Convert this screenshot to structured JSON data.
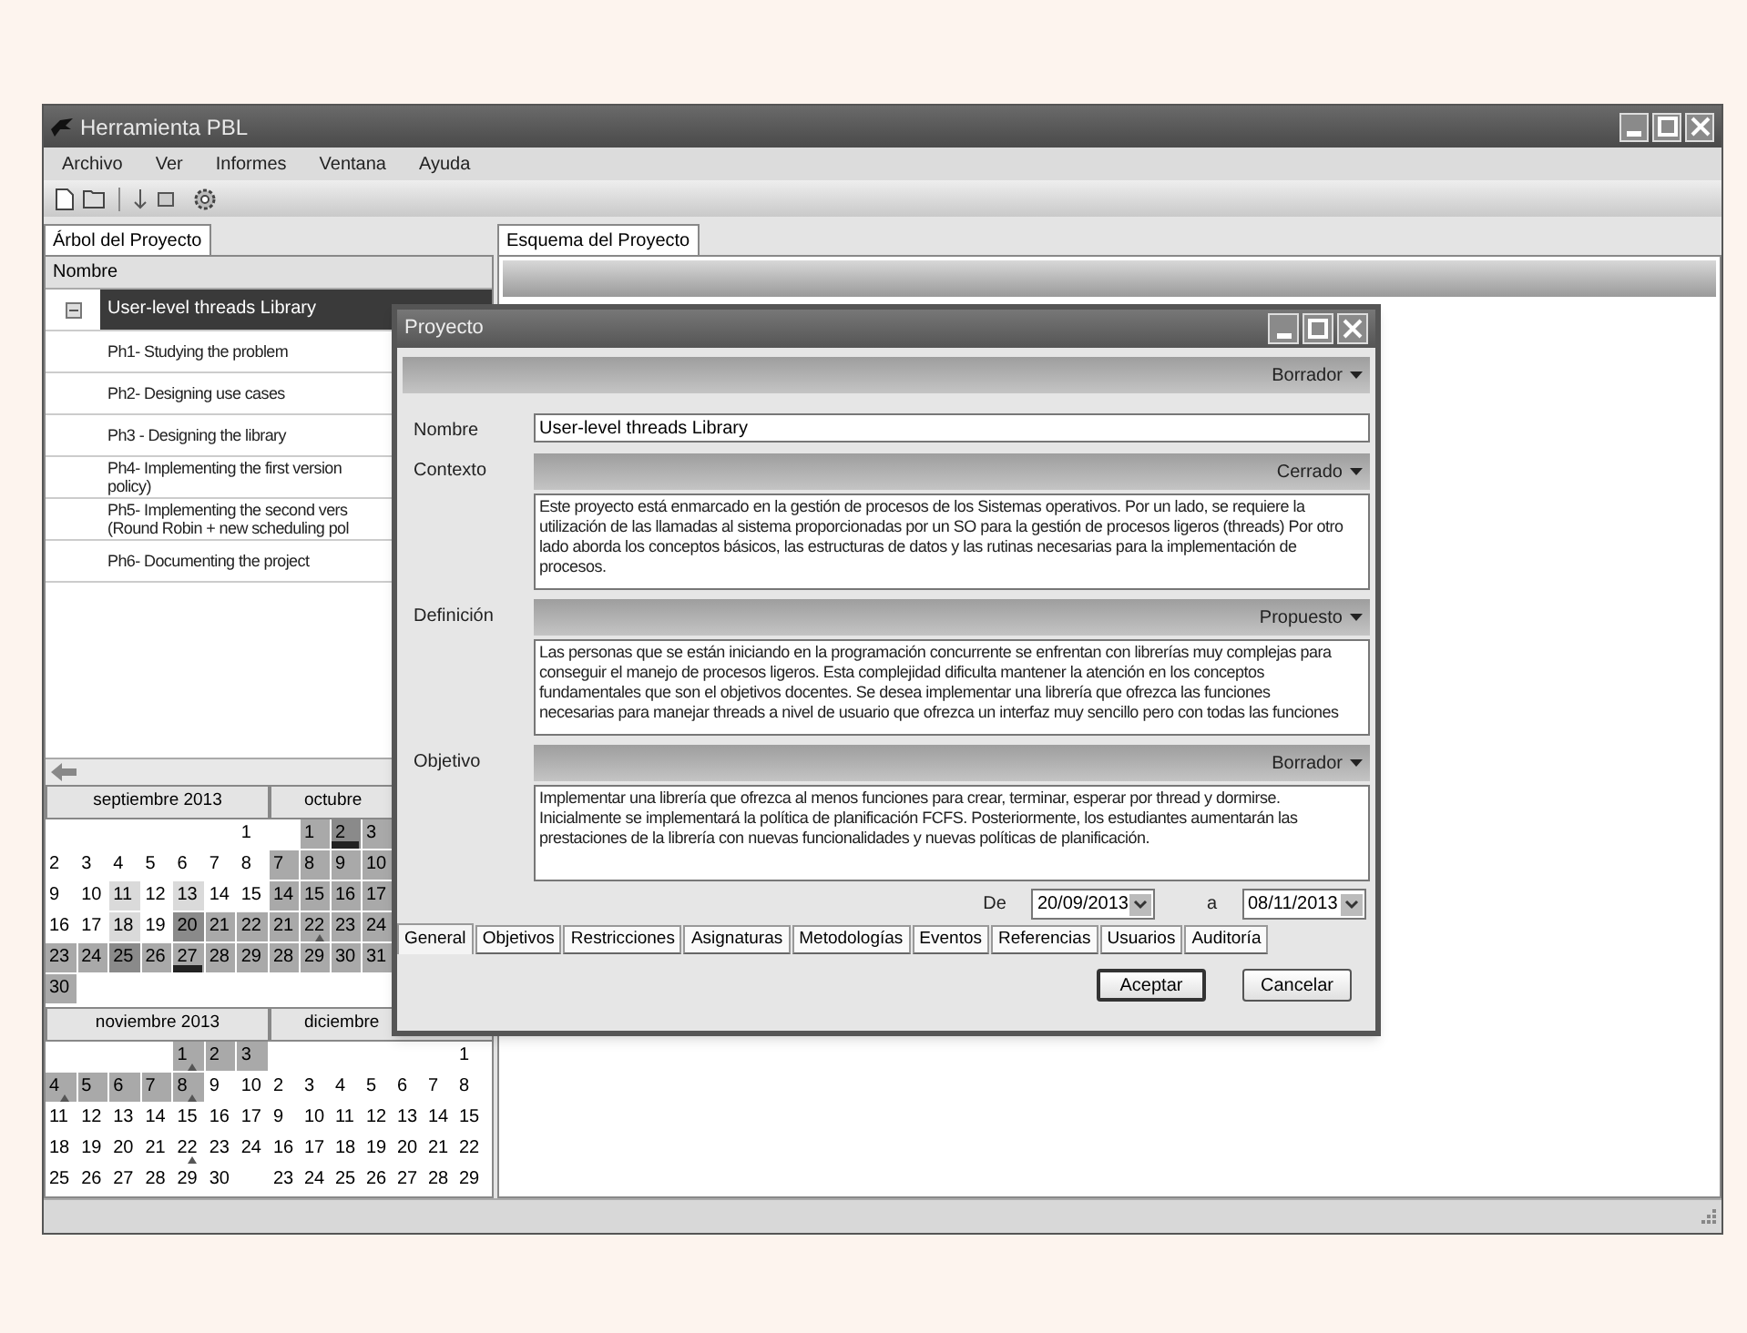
{
  "window": {
    "title": "Herramienta PBL"
  },
  "menu": [
    "Archivo",
    "Ver",
    "Informes",
    "Ventana",
    "Ayuda"
  ],
  "left_tab": {
    "label": "Árbol del Proyecto",
    "selected": true
  },
  "tree": {
    "column": "Nombre",
    "items": [
      {
        "lines": [
          "User-level threads Library"
        ],
        "selected": true,
        "expanded": true,
        "children": [
          {
            "lines": [
              "Ph1- Studying the problem"
            ],
            "selected": false
          },
          {
            "lines": [
              "Ph2- Designing use cases"
            ],
            "selected": false
          },
          {
            "lines": [
              "Ph3 - Designing the library"
            ],
            "selected": false
          },
          {
            "lines": [
              "Ph4- Implementing the first version",
              "policy)"
            ],
            "selected": false
          },
          {
            "lines": [
              "Ph5- Implementing the second vers",
              "(Round Robin + new scheduling pol"
            ],
            "selected": false
          },
          {
            "lines": [
              "Ph6- Documenting the project"
            ],
            "selected": false
          }
        ]
      }
    ]
  },
  "calendars": [
    {
      "title": "septiembre 2013",
      "weeks": [
        [
          {
            "kind": "blank"
          },
          {
            "kind": "blank"
          },
          {
            "kind": "blank"
          },
          {
            "kind": "blank"
          },
          {
            "kind": "blank"
          },
          {
            "kind": "blank"
          },
          {
            "kind": "day",
            "day": "1"
          }
        ],
        [
          {
            "kind": "day",
            "day": "2"
          },
          {
            "kind": "day",
            "day": "3"
          },
          {
            "kind": "day",
            "day": "4"
          },
          {
            "kind": "day",
            "day": "5"
          },
          {
            "kind": "day",
            "day": "6"
          },
          {
            "kind": "day",
            "day": "7"
          },
          {
            "kind": "day",
            "day": "8"
          }
        ],
        [
          {
            "kind": "day",
            "day": "9"
          },
          {
            "kind": "day",
            "day": "10"
          },
          {
            "kind": "day",
            "day": "11",
            "color": "#dadada"
          },
          {
            "kind": "day",
            "day": "12"
          },
          {
            "kind": "day",
            "day": "13",
            "color": "#dadada"
          },
          {
            "kind": "day",
            "day": "14"
          },
          {
            "kind": "day",
            "day": "15"
          }
        ],
        [
          {
            "kind": "day",
            "day": "16"
          },
          {
            "kind": "day",
            "day": "17"
          },
          {
            "kind": "day",
            "day": "18",
            "color": "#dadada"
          },
          {
            "kind": "day",
            "day": "19"
          },
          {
            "kind": "day",
            "day": "20",
            "color": "#8a8a8a"
          },
          {
            "kind": "day",
            "day": "21",
            "color": "#a9a9a9"
          },
          {
            "kind": "day",
            "day": "22",
            "color": "#a9a9a9"
          }
        ],
        [
          {
            "kind": "day",
            "day": "23",
            "color": "#a9a9a9"
          },
          {
            "kind": "day",
            "day": "24",
            "color": "#a9a9a9"
          },
          {
            "kind": "day",
            "day": "25",
            "color": "#8a8a8a"
          },
          {
            "kind": "day",
            "day": "26",
            "color": "#a9a9a9"
          },
          {
            "kind": "day",
            "day": "27",
            "color": "#a9a9a9",
            "underlined": true
          },
          {
            "kind": "day",
            "day": "28",
            "color": "#a9a9a9"
          },
          {
            "kind": "day",
            "day": "29",
            "color": "#a9a9a9"
          }
        ],
        [
          {
            "kind": "day",
            "day": "30",
            "color": "#a9a9a9"
          }
        ]
      ]
    },
    {
      "title": "octubre",
      "weeks": [
        [
          {
            "kind": "blank"
          },
          {
            "kind": "day",
            "day": "1",
            "color": "#a9a9a9"
          },
          {
            "kind": "day",
            "day": "2",
            "color": "#8a8a8a",
            "underlined": true
          },
          {
            "kind": "day",
            "day": "3",
            "color": "#a9a9a9"
          }
        ],
        [
          {
            "kind": "day",
            "day": "7",
            "color": "#a9a9a9"
          },
          {
            "kind": "day",
            "day": "8",
            "color": "#a9a9a9"
          },
          {
            "kind": "day",
            "day": "9",
            "color": "#a9a9a9"
          },
          {
            "kind": "day",
            "day": "10",
            "color": "#a9a9a9"
          }
        ],
        [
          {
            "kind": "day",
            "day": "14",
            "color": "#a9a9a9"
          },
          {
            "kind": "day",
            "day": "15",
            "color": "#a9a9a9"
          },
          {
            "kind": "day",
            "day": "16",
            "color": "#a9a9a9"
          },
          {
            "kind": "day",
            "day": "17",
            "color": "#a9a9a9"
          }
        ],
        [
          {
            "kind": "day",
            "day": "21",
            "color": "#a9a9a9"
          },
          {
            "kind": "day",
            "day": "22",
            "color": "#a9a9a9",
            "marked": true
          },
          {
            "kind": "day",
            "day": "23",
            "color": "#a9a9a9"
          },
          {
            "kind": "day",
            "day": "24",
            "color": "#a9a9a9"
          }
        ],
        [
          {
            "kind": "day",
            "day": "28",
            "color": "#a9a9a9"
          },
          {
            "kind": "day",
            "day": "29",
            "color": "#a9a9a9"
          },
          {
            "kind": "day",
            "day": "30",
            "color": "#a9a9a9"
          },
          {
            "kind": "day",
            "day": "31",
            "color": "#a9a9a9"
          }
        ]
      ]
    },
    {
      "title": "noviembre 2013",
      "weeks": [
        [
          {
            "kind": "blank"
          },
          {
            "kind": "blank"
          },
          {
            "kind": "blank"
          },
          {
            "kind": "blank"
          },
          {
            "kind": "day",
            "day": "1",
            "color": "#a9a9a9",
            "marked": true
          },
          {
            "kind": "day",
            "day": "2",
            "color": "#a9a9a9"
          },
          {
            "kind": "day",
            "day": "3",
            "color": "#a9a9a9"
          }
        ],
        [
          {
            "kind": "day",
            "day": "4",
            "color": "#a9a9a9",
            "marked": true
          },
          {
            "kind": "day",
            "day": "5",
            "color": "#a9a9a9"
          },
          {
            "kind": "day",
            "day": "6",
            "color": "#a9a9a9"
          },
          {
            "kind": "day",
            "day": "7",
            "color": "#a9a9a9"
          },
          {
            "kind": "day",
            "day": "8",
            "color": "#a9a9a9",
            "marked": true
          },
          {
            "kind": "day",
            "day": "9"
          },
          {
            "kind": "day",
            "day": "10"
          }
        ],
        [
          {
            "kind": "day",
            "day": "11"
          },
          {
            "kind": "day",
            "day": "12"
          },
          {
            "kind": "day",
            "day": "13"
          },
          {
            "kind": "day",
            "day": "14"
          },
          {
            "kind": "day",
            "day": "15"
          },
          {
            "kind": "day",
            "day": "16"
          },
          {
            "kind": "day",
            "day": "17"
          }
        ],
        [
          {
            "kind": "day",
            "day": "18"
          },
          {
            "kind": "day",
            "day": "19"
          },
          {
            "kind": "day",
            "day": "20"
          },
          {
            "kind": "day",
            "day": "21"
          },
          {
            "kind": "day",
            "day": "22",
            "marked": true
          },
          {
            "kind": "day",
            "day": "23"
          },
          {
            "kind": "day",
            "day": "24"
          }
        ],
        [
          {
            "kind": "day",
            "day": "25"
          },
          {
            "kind": "day",
            "day": "26"
          },
          {
            "kind": "day",
            "day": "27"
          },
          {
            "kind": "day",
            "day": "28"
          },
          {
            "kind": "day",
            "day": "29"
          },
          {
            "kind": "day",
            "day": "30"
          }
        ]
      ]
    },
    {
      "title": "diciembre",
      "weeks": [
        [
          {
            "kind": "blank"
          },
          {
            "kind": "blank"
          },
          {
            "kind": "blank"
          },
          {
            "kind": "blank"
          },
          {
            "kind": "blank"
          },
          {
            "kind": "blank"
          },
          {
            "kind": "day",
            "day": "1"
          }
        ],
        [
          {
            "kind": "day",
            "day": "2"
          },
          {
            "kind": "day",
            "day": "3"
          },
          {
            "kind": "day",
            "day": "4"
          },
          {
            "kind": "day",
            "day": "5"
          },
          {
            "kind": "day",
            "day": "6"
          },
          {
            "kind": "day",
            "day": "7"
          },
          {
            "kind": "day",
            "day": "8"
          }
        ],
        [
          {
            "kind": "day",
            "day": "9"
          },
          {
            "kind": "day",
            "day": "10"
          },
          {
            "kind": "day",
            "day": "11"
          },
          {
            "kind": "day",
            "day": "12"
          },
          {
            "kind": "day",
            "day": "13"
          },
          {
            "kind": "day",
            "day": "14"
          },
          {
            "kind": "day",
            "day": "15"
          }
        ],
        [
          {
            "kind": "day",
            "day": "16"
          },
          {
            "kind": "day",
            "day": "17"
          },
          {
            "kind": "day",
            "day": "18"
          },
          {
            "kind": "day",
            "day": "19"
          },
          {
            "kind": "day",
            "day": "20"
          },
          {
            "kind": "day",
            "day": "21"
          },
          {
            "kind": "day",
            "day": "22"
          }
        ],
        [
          {
            "kind": "day",
            "day": "23"
          },
          {
            "kind": "day",
            "day": "24"
          },
          {
            "kind": "day",
            "day": "25"
          },
          {
            "kind": "day",
            "day": "26"
          },
          {
            "kind": "day",
            "day": "27"
          },
          {
            "kind": "day",
            "day": "28"
          },
          {
            "kind": "day",
            "day": "29"
          }
        ]
      ]
    }
  ],
  "right_tab": {
    "label": "Esquema del Proyecto",
    "selected": true
  },
  "dialog": {
    "title": "Proyecto",
    "status": "Borrador",
    "fields": [
      {
        "kind": "input",
        "label": "Nombre",
        "value": "User-level threads Library"
      },
      {
        "kind": "text",
        "label": "Contexto",
        "status": "Cerrado",
        "lines": [
          "Este proyecto está enmarcado en la gestión de procesos de los Sistemas operativos. Por un lado, se requiere la",
          "utilización de las llamadas al sistema proporcionadas por un SO para la gestión de procesos ligeros (threads) Por otro",
          "lado aborda los conceptos básicos, las estructuras de datos y las rutinas necesarias para la implementación de",
          "procesos."
        ]
      },
      {
        "kind": "text",
        "label": "Definición",
        "status": "Propuesto",
        "lines": [
          "Las personas que se están iniciando en la programación concurrente se enfrentan con librerías muy complejas para",
          "conseguir el manejo de procesos ligeros. Esta complejidad dificulta mantener la atención en los conceptos",
          "fundamentales que son el objetivos docentes. Se desea implementar una librería que ofrezca las funciones",
          "necesarias para manejar threads a nivel de usuario que ofrezca un interfaz muy sencillo pero con todas las funciones"
        ]
      },
      {
        "kind": "text",
        "label": "Objetivo",
        "status": "Borrador",
        "lines": [
          "Implementar una librería que ofrezca al menos funciones para crear, terminar, esperar por thread y dormirse.",
          "Inicialmente se implementará la política de planificación FCFS. Posteriormente, los estudiantes  aumentarán las",
          "prestaciones de la librería con nuevas funcionalidades y nuevas políticas de planificación."
        ]
      }
    ],
    "date_from_label": "De",
    "date_from": "20/09/2013",
    "date_to_label": "a",
    "date_to": "08/11/2013",
    "tabs": [
      {
        "label": "General",
        "selected": true
      },
      {
        "label": "Objetivos",
        "selected": false
      },
      {
        "label": "Restricciones",
        "selected": false
      },
      {
        "label": "Asignaturas",
        "selected": false
      },
      {
        "label": "Metodologías",
        "selected": false
      },
      {
        "label": "Eventos",
        "selected": false
      },
      {
        "label": "Referencias",
        "selected": false
      },
      {
        "label": "Usuarios",
        "selected": false
      },
      {
        "label": "Auditoría",
        "selected": false
      }
    ],
    "buttons": [
      {
        "label": "Aceptar",
        "default": true
      },
      {
        "label": "Cancelar",
        "default": false
      }
    ]
  }
}
